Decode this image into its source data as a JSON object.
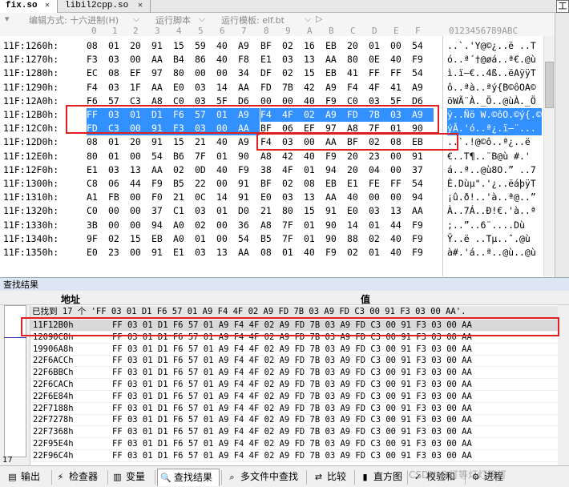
{
  "tabs": [
    {
      "label": "fix.so",
      "close": "✕"
    },
    {
      "label": "libil2cpp.so",
      "close": "✕"
    }
  ],
  "toolbar": {
    "edit_mode": "编辑方式: 十六进制(H)",
    "run_script": "运行脚本",
    "run_template": "运行模板: elf.bt",
    "play": "▷",
    "dropdown": "⌵"
  },
  "right_panel_label": "工",
  "column_header": {
    "offsets": [
      "0",
      "1",
      "2",
      "3",
      "4",
      "5",
      "6",
      "7",
      "8",
      "9",
      "A",
      "B",
      "C",
      "D",
      "E",
      "F"
    ],
    "ascii": "0123456789ABC"
  },
  "hex_rows": [
    {
      "addr": "11F:1260h:",
      "bytes": [
        "08",
        "01",
        "20",
        "91",
        "15",
        "59",
        "40",
        "A9",
        "BF",
        "02",
        "16",
        "EB",
        "20",
        "01",
        "00",
        "54"
      ],
      "ascii": "..`.'Y@©¿..ë ..T"
    },
    {
      "addr": "11F:1270h:",
      "bytes": [
        "F3",
        "03",
        "00",
        "AA",
        "B4",
        "86",
        "40",
        "F8",
        "E1",
        "03",
        "13",
        "AA",
        "80",
        "0E",
        "40",
        "F9"
      ],
      "ascii": "ó..ª´†@øá..ª€.@ù"
    },
    {
      "addr": "11F:1280h:",
      "bytes": [
        "EC",
        "08",
        "EF",
        "97",
        "80",
        "00",
        "00",
        "34",
        "DF",
        "02",
        "15",
        "EB",
        "41",
        "FF",
        "FF",
        "54"
      ],
      "ascii": "ì.ï—€..4ß..ëAÿÿT"
    },
    {
      "addr": "11F:1290h:",
      "bytes": [
        "F4",
        "03",
        "1F",
        "AA",
        "E0",
        "03",
        "14",
        "AA",
        "FD",
        "7B",
        "42",
        "A9",
        "F4",
        "4F",
        "41",
        "A9"
      ],
      "ascii": "ô..ªà..ªý{B©ôOA©"
    },
    {
      "addr": "11F:12A0h:",
      "bytes": [
        "F6",
        "57",
        "C3",
        "A8",
        "C0",
        "03",
        "5F",
        "D6",
        "00",
        "00",
        "40",
        "F9",
        "C0",
        "03",
        "5F",
        "D6"
      ],
      "ascii": "öWÃ¨À._Ö..@ùÀ._Ö"
    },
    {
      "addr": "11F:12B0h:",
      "bytes": [
        "FF",
        "03",
        "01",
        "D1",
        "F6",
        "57",
        "01",
        "A9",
        "F4",
        "4F",
        "02",
        "A9",
        "FD",
        "7B",
        "03",
        "A9"
      ],
      "ascii": "ÿ..Ñö W.©ôO.©ý{.©"
    },
    {
      "addr": "11F:12C0h:",
      "bytes": [
        "FD",
        "C3",
        "00",
        "91",
        "F3",
        "03",
        "00",
        "AA",
        "BF",
        "06",
        "EF",
        "97",
        "A8",
        "7F",
        "01",
        "90"
      ],
      "ascii": "ýÃ.'ó..ª¿.ï—¨..."
    },
    {
      "addr": "11F:12D0h:",
      "bytes": [
        "08",
        "01",
        "20",
        "91",
        "15",
        "21",
        "40",
        "A9",
        "F4",
        "03",
        "00",
        "AA",
        "BF",
        "02",
        "08",
        "EB"
      ],
      "ascii": "..`.!@©ô..ª¿..ë"
    },
    {
      "addr": "11F:12E0h:",
      "bytes": [
        "80",
        "01",
        "00",
        "54",
        "B6",
        "7F",
        "01",
        "90",
        "A8",
        "42",
        "40",
        "F9",
        "20",
        "23",
        "00",
        "91"
      ],
      "ascii": "€..T¶..¨B@ù #.'"
    },
    {
      "addr": "11F:12F0h:",
      "bytes": [
        "E1",
        "03",
        "13",
        "AA",
        "02",
        "0D",
        "40",
        "F9",
        "38",
        "4F",
        "01",
        "94",
        "20",
        "04",
        "00",
        "37"
      ],
      "ascii": "á..ª..@ù8O.” ..7"
    },
    {
      "addr": "11F:1300h:",
      "bytes": [
        "C8",
        "06",
        "44",
        "F9",
        "B5",
        "22",
        "00",
        "91",
        "BF",
        "02",
        "08",
        "EB",
        "E1",
        "FE",
        "FF",
        "54"
      ],
      "ascii": "È.Dùµ\".'¿..ëáþÿT"
    },
    {
      "addr": "11F:1310h:",
      "bytes": [
        "A1",
        "FB",
        "00",
        "F0",
        "21",
        "0C",
        "14",
        "91",
        "E0",
        "03",
        "13",
        "AA",
        "40",
        "00",
        "00",
        "94"
      ],
      "ascii": "¡û.ð!..'à..ª@..”"
    },
    {
      "addr": "11F:1320h:",
      "bytes": [
        "C0",
        "00",
        "00",
        "37",
        "C1",
        "03",
        "01",
        "D0",
        "21",
        "80",
        "15",
        "91",
        "E0",
        "03",
        "13",
        "AA"
      ],
      "ascii": "À..7Á..Ð!€.'à..ª"
    },
    {
      "addr": "11F:1330h:",
      "bytes": [
        "3B",
        "00",
        "00",
        "94",
        "A0",
        "02",
        "00",
        "36",
        "A8",
        "7F",
        "01",
        "90",
        "14",
        "01",
        "44",
        "F9"
      ],
      "ascii": ";..”..6¨....Dù"
    },
    {
      "addr": "11F:1340h:",
      "bytes": [
        "9F",
        "02",
        "15",
        "EB",
        "A0",
        "01",
        "00",
        "54",
        "B5",
        "7F",
        "01",
        "90",
        "88",
        "02",
        "40",
        "F9"
      ],
      "ascii": "Ÿ..ë ..Tµ..ˆ.@ù"
    },
    {
      "addr": "11F:1350h:",
      "bytes": [
        "E0",
        "23",
        "00",
        "91",
        "E1",
        "03",
        "13",
        "AA",
        "08",
        "01",
        "40",
        "F9",
        "02",
        "01",
        "40",
        "F9"
      ],
      "ascii": "à#.'á..ª..@ù..@ù"
    }
  ],
  "find": {
    "title": "查找结果",
    "col_addr": "地址",
    "col_value": "值",
    "summary": "已找到 17 个 'FF 03 01 D1 F6 57 01 A9 F4 4F 02 A9 FD 7B 03 A9 FD C3 00 91 F3 03 00 AA'.",
    "value": "FF 03 01 D1 F6 57 01 A9 F4 4F 02 A9 FD 7B 03 A9 FD C3 00 91 F3 03 00 AA",
    "addresses": [
      "11F12B0h",
      "12090C8h",
      "19906A8h",
      "22F6ACCh",
      "22F6BBCh",
      "22F6CACh",
      "22F6E84h",
      "22F7188h",
      "22F7278h",
      "22F7368h",
      "22F95E4h",
      "22F96C4h"
    ],
    "gutter_count": "17"
  },
  "bottom_tabs": [
    {
      "label": "输出",
      "icon": "▤"
    },
    {
      "label": "检查器",
      "icon": "⚡"
    },
    {
      "label": "变量",
      "icon": "▥"
    },
    {
      "label": "查找结果",
      "icon": "🔍"
    },
    {
      "label": "多文件中查找",
      "icon": "⌕"
    },
    {
      "label": "比较",
      "icon": "⇄"
    },
    {
      "label": "直方图",
      "icon": "▮"
    },
    {
      "label": "校验和",
      "icon": "✓"
    },
    {
      "label": "进程",
      "icon": "⚙"
    }
  ],
  "watermark": "CSDN @灯等灯灯等灯"
}
